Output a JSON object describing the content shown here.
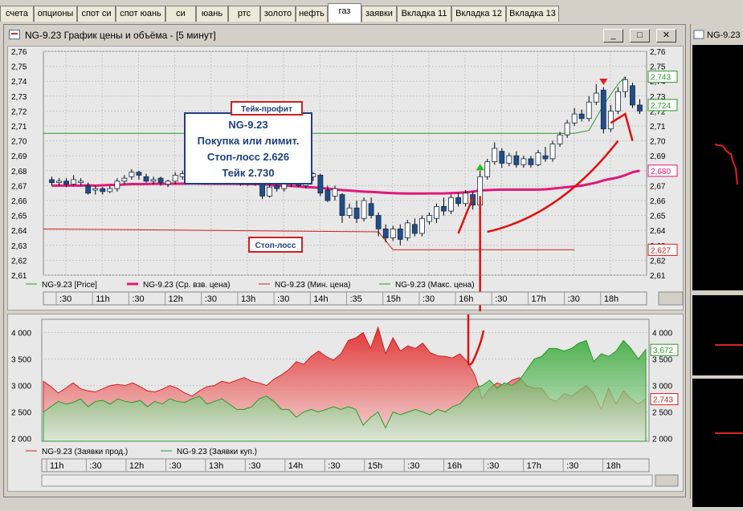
{
  "tabs": [
    {
      "label": "счета",
      "w": 42
    },
    {
      "label": "опционы",
      "w": 54
    },
    {
      "label": "спот си",
      "w": 48
    },
    {
      "label": "спот юань",
      "w": 62
    },
    {
      "label": "си",
      "w": 38
    },
    {
      "label": "юань",
      "w": 40
    },
    {
      "label": "ртс",
      "w": 40
    },
    {
      "label": "золото",
      "w": 44
    },
    {
      "label": "нефть",
      "w": 40
    },
    {
      "label": "газ",
      "w": 42,
      "active": true
    },
    {
      "label": "заявки",
      "w": 44
    },
    {
      "label": "Вкладка 11",
      "w": 68
    },
    {
      "label": "Вкладка 12",
      "w": 68
    },
    {
      "label": "Вкладка 13",
      "w": 66
    }
  ],
  "window": {
    "title": "NG-9.23 График цены и объёма - [5 минут]",
    "btn_min": "_",
    "btn_max": "□",
    "btn_close": "✕"
  },
  "side_window": {
    "title": "NG-9.23"
  },
  "price_chart": {
    "y_ticks": [
      "2,76",
      "2,75",
      "2,74",
      "2,73",
      "2,72",
      "2,71",
      "2,70",
      "2,69",
      "2,68",
      "2,67",
      "2,66",
      "2,65",
      "2,64",
      "2,63",
      "2,62",
      "2,61"
    ],
    "y_min": 2.61,
    "y_max": 2.76,
    "right_labels": [
      {
        "text": "2,743",
        "value": 2.743,
        "color": "#2a9a2a"
      },
      {
        "text": "2,724",
        "value": 2.724,
        "color": "#2a9a2a"
      },
      {
        "text": "2,680",
        "value": 2.68,
        "color": "#e0187a"
      },
      {
        "text": "2,627",
        "value": 2.627,
        "color": "#d02020"
      }
    ],
    "annotation_box": {
      "line1": "NG-9.23",
      "line2": "Покупка или лимит.",
      "line3": "Стоп-лосс 2.626",
      "line4": "Тейк 2.730"
    },
    "take_profit_label": "Тейк-профит",
    "stop_loss_label": "Стоп-лосс",
    "take_profit_level": 2.705,
    "stop_loss_level": 2.641,
    "legend": [
      {
        "label": "NG-9.23 [Price]",
        "color": "#2a9a2a"
      },
      {
        "label": "NG-9.23 (Ср. взв. цена)",
        "color": "#e0187a"
      },
      {
        "label": "NG-9.23 (Мин. цена)",
        "color": "#d02020"
      },
      {
        "label": "NG-9.23 (Макс. цена)",
        "color": "#2a9a2a"
      }
    ],
    "x_labels": [
      ":30",
      "11h",
      ":30",
      "12h",
      ":30",
      "13h",
      ":30",
      "14h",
      ":35",
      "15h",
      ":30",
      "16h",
      ":30",
      "17h",
      ":30",
      "18h"
    ],
    "candles": [
      [
        2.674,
        2.672,
        2.676,
        2.67
      ],
      [
        2.672,
        2.673,
        2.675,
        2.67
      ],
      [
        2.673,
        2.671,
        2.675,
        2.669
      ],
      [
        2.671,
        2.674,
        2.677,
        2.67
      ],
      [
        2.672,
        2.673,
        2.675,
        2.67
      ],
      [
        2.67,
        2.665,
        2.672,
        2.664
      ],
      [
        2.667,
        2.668,
        2.67,
        2.664
      ],
      [
        2.668,
        2.666,
        2.669,
        2.664
      ],
      [
        2.666,
        2.668,
        2.67,
        2.665
      ],
      [
        2.668,
        2.673,
        2.675,
        2.666
      ],
      [
        2.673,
        2.675,
        2.677,
        2.671
      ],
      [
        2.676,
        2.679,
        2.681,
        2.674
      ],
      [
        2.679,
        2.677,
        2.68,
        2.674
      ],
      [
        2.676,
        2.673,
        2.678,
        2.672
      ],
      [
        2.673,
        2.674,
        2.676,
        2.671
      ],
      [
        2.675,
        2.672,
        2.676,
        2.67
      ],
      [
        2.671,
        2.673,
        2.674,
        2.669
      ],
      [
        2.673,
        2.677,
        2.679,
        2.671
      ],
      [
        2.676,
        2.678,
        2.68,
        2.674
      ],
      [
        2.678,
        2.676,
        2.68,
        2.674
      ],
      [
        2.676,
        2.674,
        2.677,
        2.672
      ],
      [
        2.674,
        2.675,
        2.677,
        2.672
      ],
      [
        2.675,
        2.673,
        2.677,
        2.671
      ],
      [
        2.673,
        2.672,
        2.676,
        2.671
      ],
      [
        2.673,
        2.676,
        2.678,
        2.671
      ],
      [
        2.675,
        2.673,
        2.677,
        2.672
      ],
      [
        2.672,
        2.671,
        2.675,
        2.67
      ],
      [
        2.671,
        2.673,
        2.675,
        2.67
      ],
      [
        2.673,
        2.672,
        2.674,
        2.67
      ],
      [
        2.671,
        2.663,
        2.672,
        2.661
      ],
      [
        2.663,
        2.669,
        2.671,
        2.662
      ],
      [
        2.67,
        2.668,
        2.672,
        2.666
      ],
      [
        2.668,
        2.671,
        2.673,
        2.666
      ],
      [
        2.671,
        2.676,
        2.678,
        2.669
      ],
      [
        2.676,
        2.67,
        2.678,
        2.669
      ],
      [
        2.67,
        2.674,
        2.676,
        2.668
      ],
      [
        2.676,
        2.678,
        2.679,
        2.673
      ],
      [
        2.677,
        2.665,
        2.678,
        2.663
      ],
      [
        2.667,
        2.66,
        2.67,
        2.659
      ],
      [
        2.663,
        2.668,
        2.67,
        2.66
      ],
      [
        2.664,
        2.65,
        2.665,
        2.645
      ],
      [
        2.65,
        2.655,
        2.658,
        2.648
      ],
      [
        2.655,
        2.648,
        2.66,
        2.645
      ],
      [
        2.648,
        2.66,
        2.662,
        2.646
      ],
      [
        2.658,
        2.65,
        2.662,
        2.648
      ],
      [
        2.65,
        2.641,
        2.652,
        2.636
      ],
      [
        2.641,
        2.635,
        2.644,
        2.632
      ],
      [
        2.635,
        2.641,
        2.643,
        2.633
      ],
      [
        2.641,
        2.634,
        2.644,
        2.63
      ],
      [
        2.635,
        2.645,
        2.647,
        2.633
      ],
      [
        2.644,
        2.638,
        2.648,
        2.636
      ],
      [
        2.638,
        2.648,
        2.65,
        2.636
      ],
      [
        2.646,
        2.65,
        2.652,
        2.644
      ],
      [
        2.648,
        2.656,
        2.658,
        2.645
      ],
      [
        2.656,
        2.653,
        2.662,
        2.65
      ],
      [
        2.653,
        2.662,
        2.664,
        2.651
      ],
      [
        2.662,
        2.658,
        2.665,
        2.656
      ],
      [
        2.658,
        2.665,
        2.667,
        2.656
      ],
      [
        2.664,
        2.657,
        2.666,
        2.654
      ],
      [
        2.657,
        2.676,
        2.68,
        2.656
      ],
      [
        2.676,
        2.686,
        2.688,
        2.674
      ],
      [
        2.686,
        2.695,
        2.699,
        2.684
      ],
      [
        2.693,
        2.685,
        2.695,
        2.682
      ],
      [
        2.685,
        2.69,
        2.692,
        2.683
      ],
      [
        2.69,
        2.684,
        2.693,
        2.682
      ],
      [
        2.684,
        2.688,
        2.69,
        2.682
      ],
      [
        2.688,
        2.684,
        2.69,
        2.682
      ],
      [
        2.684,
        2.692,
        2.694,
        2.683
      ],
      [
        2.69,
        2.688,
        2.696,
        2.686
      ],
      [
        2.688,
        2.698,
        2.7,
        2.686
      ],
      [
        2.698,
        2.704,
        2.706,
        2.696
      ],
      [
        2.704,
        2.712,
        2.714,
        2.702
      ],
      [
        2.712,
        2.718,
        2.722,
        2.71
      ],
      [
        2.718,
        2.715,
        2.721,
        2.713
      ],
      [
        2.715,
        2.726,
        2.73,
        2.713
      ],
      [
        2.726,
        2.732,
        2.738,
        2.724
      ],
      [
        2.734,
        2.708,
        2.736,
        2.705
      ],
      [
        2.708,
        2.72,
        2.724,
        2.706
      ],
      [
        2.72,
        2.733,
        2.736,
        2.718
      ],
      [
        2.733,
        2.741,
        2.743,
        2.729
      ],
      [
        2.737,
        2.724,
        2.739,
        2.722
      ],
      [
        2.724,
        2.72,
        2.728,
        2.718
      ]
    ],
    "vwap": [
      2.67,
      2.67,
      2.67,
      2.67,
      2.67,
      2.6702,
      2.67,
      2.6702,
      2.6705,
      2.6705,
      2.6708,
      2.671,
      2.671,
      2.6711,
      2.6712,
      2.6712,
      2.6712,
      2.6713,
      2.6713,
      2.6714,
      2.6714,
      2.6713,
      2.6713,
      2.6712,
      2.6712,
      2.6712,
      2.6711,
      2.6711,
      2.671,
      2.671,
      2.6705,
      2.67,
      2.67,
      2.6698,
      2.6695,
      2.669,
      2.6688,
      2.6685,
      2.668,
      2.6675,
      2.667,
      2.6667,
      2.6663,
      2.666,
      2.6658,
      2.6655,
      2.6652,
      2.665,
      2.6648,
      2.6647,
      2.6647,
      2.6647,
      2.6648,
      2.6648,
      2.6648,
      2.665,
      2.6652,
      2.6655,
      2.666,
      2.6668,
      2.667,
      2.6672,
      2.6673,
      2.6673,
      2.6673,
      2.6673,
      2.6673,
      2.6673,
      2.6675,
      2.668,
      2.6685,
      2.669,
      2.6695,
      2.67,
      2.671,
      2.672,
      2.6735,
      2.6745,
      2.6755,
      2.677,
      2.679,
      2.68
    ]
  },
  "volume_chart": {
    "y_ticks": [
      "4 000",
      "3 500",
      "3 000",
      "2 500",
      "2 000"
    ],
    "y_min": 1950,
    "y_max": 4250,
    "right_labels": [
      {
        "text": "3,672",
        "value": 3672,
        "color": "#2a9a2a"
      },
      {
        "text": "2,743",
        "value": 2743,
        "color": "#d02020"
      }
    ],
    "legend": [
      {
        "label": "NG-9.23 (Заявки прод.)",
        "color": "#d02020"
      },
      {
        "label": "NG-9.23 (Заявки куп.)",
        "color": "#2a9a2a"
      }
    ],
    "x_labels": [
      "11h",
      ":30",
      "12h",
      ":30",
      "13h",
      ":30",
      "14h",
      ":30",
      "15h",
      ":30",
      "16h",
      ":30",
      "17h",
      ":30",
      "18h"
    ],
    "sell": [
      3080,
      2980,
      2860,
      2950,
      3050,
      2940,
      2900,
      2880,
      2940,
      3000,
      3020,
      3000,
      3050,
      2980,
      2900,
      2880,
      2930,
      3000,
      2950,
      2860,
      2800,
      2900,
      2980,
      3000,
      3080,
      3050,
      3100,
      3150,
      3080,
      3050,
      3000,
      3120,
      3200,
      3300,
      3450,
      3400,
      3550,
      3650,
      3550,
      3480,
      3600,
      3850,
      3900,
      4000,
      3700,
      4100,
      3600,
      3900,
      3650,
      3750,
      3700,
      3800,
      3620,
      3560,
      3550,
      3520,
      3600,
      3450,
      3200,
      2750,
      2950,
      3050,
      3000,
      3100,
      3150,
      3000,
      2950,
      2950,
      2750,
      2700,
      2850,
      2800,
      2900,
      3000,
      2850,
      2550,
      2950,
      2650,
      2900,
      2750,
      2650,
      2750
    ],
    "buy": [
      2500,
      2600,
      2700,
      2650,
      2680,
      2750,
      2600,
      2700,
      2720,
      2650,
      2750,
      2700,
      2680,
      2720,
      2600,
      2700,
      2650,
      2750,
      2700,
      2680,
      2750,
      2800,
      2650,
      2700,
      2750,
      2650,
      2550,
      2550,
      2600,
      2750,
      2800,
      2700,
      2550,
      2550,
      2400,
      2500,
      2550,
      2500,
      2550,
      2600,
      2550,
      2600,
      2550,
      2250,
      2400,
      2500,
      2200,
      2500,
      2450,
      2500,
      2550,
      2500,
      2450,
      2550,
      2500,
      2600,
      2650,
      2800,
      2950,
      3000,
      3100,
      2950,
      3050,
      3000,
      3100,
      3300,
      3500,
      3550,
      3700,
      3700,
      3650,
      3700,
      3800,
      3850,
      3450,
      3600,
      3550,
      3650,
      3850,
      3700,
      3500,
      3680
    ]
  }
}
